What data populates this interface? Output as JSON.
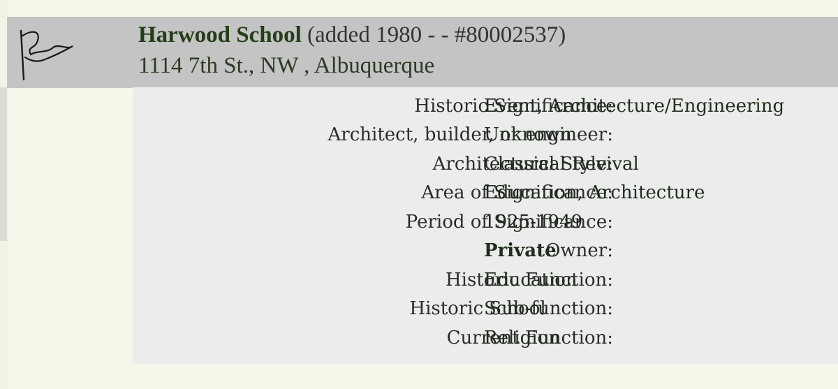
{
  "entry": {
    "name": "Harwood School",
    "added_info": "(added 1980 - - #80002537)",
    "address": "1114 7th St., NW , Albuquerque",
    "icon": "flag-icon"
  },
  "details": [
    {
      "label": "Historic Significance:",
      "value": "Event, Architecture/Engineering",
      "bold": false
    },
    {
      "label": "Architect, builder, or engineer:",
      "value": "Unknown",
      "bold": false
    },
    {
      "label": "Architectural Style:",
      "value": "Classical Revival",
      "bold": false
    },
    {
      "label": "Area of Significance:",
      "value": "Education, Architecture",
      "bold": false
    },
    {
      "label": "Period of Significance:",
      "value": "1925-1949",
      "bold": false
    },
    {
      "label": "Owner:",
      "value": "Private",
      "bold": true
    },
    {
      "label": "Historic Function:",
      "value": "Education",
      "bold": false
    },
    {
      "label": "Historic Sub-function:",
      "value": "School",
      "bold": false
    },
    {
      "label": "Current Function:",
      "value": "Religion",
      "bold": false
    }
  ],
  "colors": {
    "header_bg": "#c4c4c4",
    "details_bg": "#ececec",
    "page_bg": "#f6f6ea",
    "title_green": "#243e18"
  }
}
